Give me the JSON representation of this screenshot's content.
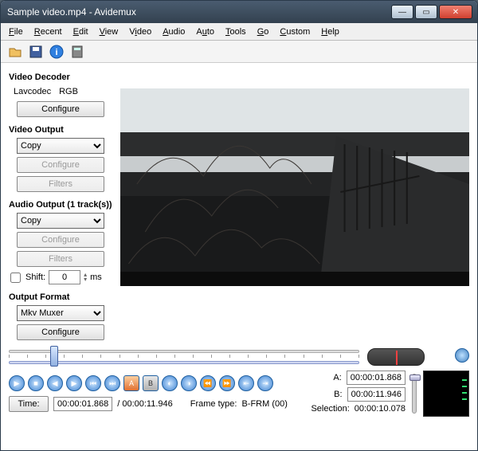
{
  "window": {
    "title": "Sample video.mp4 - Avidemux"
  },
  "menu": {
    "file": "File",
    "recent": "Recent",
    "edit": "Edit",
    "view": "View",
    "video": "Video",
    "audio": "Audio",
    "auto": "Auto",
    "tools": "Tools",
    "go": "Go",
    "custom": "Custom",
    "help": "Help"
  },
  "decoder": {
    "title": "Video Decoder",
    "codec": "Lavcodec",
    "color": "RGB",
    "configure": "Configure"
  },
  "video_out": {
    "title": "Video Output",
    "value": "Copy",
    "configure": "Configure",
    "filters": "Filters"
  },
  "audio_out": {
    "title": "Audio Output (1 track(s))",
    "value": "Copy",
    "configure": "Configure",
    "filters": "Filters",
    "shift_label": "Shift:",
    "shift_val": "0",
    "ms": "ms"
  },
  "format": {
    "title": "Output Format",
    "value": "Mkv Muxer",
    "configure": "Configure"
  },
  "marks": {
    "a_label": "A:",
    "a_val": "00:00:01.868",
    "b_label": "B:",
    "b_val": "00:00:11.946",
    "sel_label": "Selection:",
    "sel_val": "00:00:10.078"
  },
  "time": {
    "label": "Time:",
    "current": "00:00:01.868",
    "total": "/ 00:00:11.946",
    "frame_label": "Frame type:",
    "frame_val": "B-FRM (00)"
  }
}
